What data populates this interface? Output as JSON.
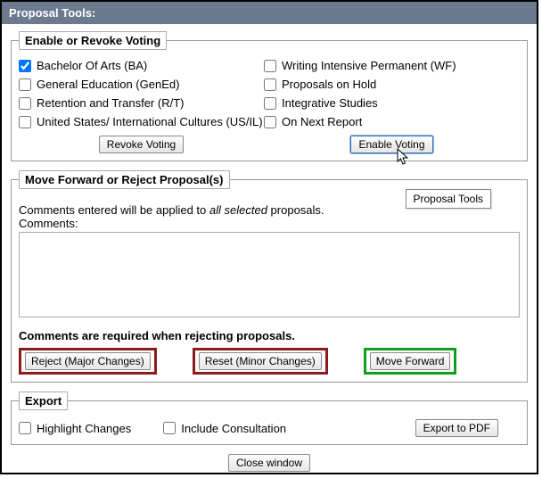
{
  "titlebar": "Proposal Tools:",
  "voting": {
    "legend": "Enable or Revoke Voting",
    "options": [
      {
        "label": "Bachelor Of Arts (BA)",
        "checked": true
      },
      {
        "label": "Writing Intensive Permanent (WF)",
        "checked": false
      },
      {
        "label": "General Education (GenEd)",
        "checked": false
      },
      {
        "label": "Proposals on Hold",
        "checked": false
      },
      {
        "label": "Retention and Transfer (R/T)",
        "checked": false
      },
      {
        "label": "Integrative Studies",
        "checked": false
      },
      {
        "label": "United States/ International Cultures (US/IL)",
        "checked": false
      },
      {
        "label": "On Next Report",
        "checked": false
      }
    ],
    "revoke_label": "Revoke Voting",
    "enable_label": "Enable Voting",
    "tooltip": "Proposal Tools"
  },
  "move": {
    "legend": "Move Forward or Reject Proposal(s)",
    "instr_prefix": "Comments entered will be applied to ",
    "instr_italic": "all selected",
    "instr_suffix": " proposals.",
    "comments_label": "Comments:",
    "comments_value": "",
    "required_note": "Comments are required when rejecting proposals.",
    "reject_label": "Reject (Major Changes)",
    "reset_label": "Reset (Minor Changes)",
    "forward_label": "Move Forward"
  },
  "export": {
    "legend": "Export",
    "highlight_label": "Highlight Changes",
    "highlight_checked": false,
    "consult_label": "Include Consultation",
    "consult_checked": false,
    "export_label": "Export to PDF"
  },
  "footer": {
    "close_label": "Close window"
  }
}
